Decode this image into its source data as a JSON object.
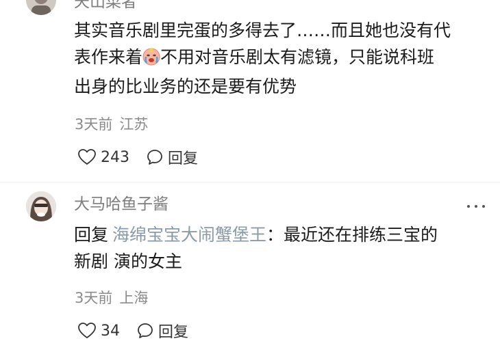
{
  "comments": [
    {
      "username": "天山菜者",
      "text_line1": "其实音乐剧里完蛋的多得去了……而且她也没有代",
      "text_line2_before": "表作来着",
      "emoji": "crying-face-emoji",
      "text_line2_after": "不用对音乐剧太有滤镜，只能说科班",
      "text_line3": "出身的比业务的还是要有优势",
      "time": "3天前",
      "location": "江苏",
      "likes": "243",
      "reply_label": "回复"
    },
    {
      "username": "大马哈鱼子酱",
      "reply_prefix": "回复",
      "reply_target": "海绵宝宝大闹蟹堡王",
      "reply_colon": "：",
      "text_line1_after": "最近还在排练三宝的",
      "text_line2": "新剧 演的女主",
      "time": "3天前",
      "location": "上海",
      "likes": "34",
      "reply_label": "回复"
    }
  ],
  "colors": {
    "username": "#7d7d7d",
    "reply_target": "#8a9aa8",
    "meta": "#8a8a8a",
    "text": "#1a1a1a"
  }
}
